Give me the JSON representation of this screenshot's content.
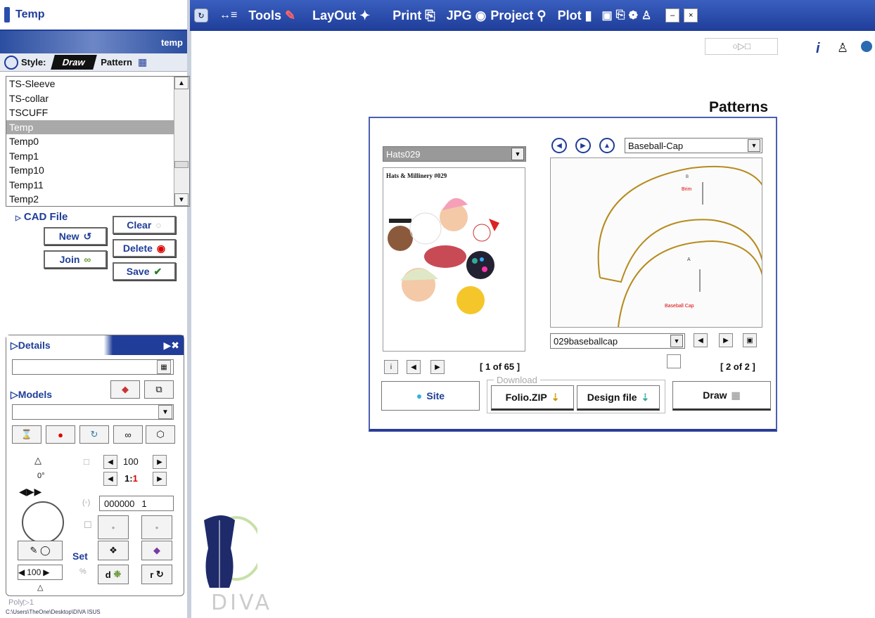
{
  "window": {
    "title": "Temp"
  },
  "toolbar": {
    "tools": "Tools",
    "layout": "LayOut",
    "print": "Print",
    "jpg": "JPG",
    "project": "Project",
    "plot": "Plot",
    "minimize": "–",
    "close": "×"
  },
  "left": {
    "banner_label": "temp",
    "style_label": "Style:",
    "tab_draw": "Draw",
    "tab_pattern": "Pattern",
    "patterns": [
      "TS-Sleeve",
      "TS-collar",
      "TSCUFF",
      "Temp",
      "Temp0",
      "Temp1",
      "Temp10",
      "Temp11",
      "Temp2"
    ],
    "selected_pattern": "Temp",
    "cad_file": "CAD File",
    "new": "New",
    "join": "Join",
    "clear": "Clear",
    "delete": "Delete",
    "save": "Save",
    "details": "Details",
    "models": "Models",
    "angle": "0°",
    "zoom_value": "100",
    "scale_prefix": "1:",
    "scale_value": "1",
    "counter_value": "000000",
    "counter_index": "1",
    "set": "Set",
    "percent_value": "100",
    "percent_sign": "%",
    "d_label": "d",
    "r_label": "r",
    "poly": "Poly▷1",
    "filepath": "C:\\Users\\TheOne\\Desktop\\DIVA ISUS"
  },
  "main": {
    "title": "Patterns",
    "catalog_select": "Hats029",
    "catalog_header": "Hats & Millinery #029",
    "catalog_counter": "[ 1 of 65 ]",
    "pattern_select": "Baseball-Cap",
    "piece_select": "029baseballcap",
    "piece_counter": "[ 2 of 2 ]",
    "preview_brim": "Brim",
    "preview_cap": "Baseball Cap",
    "preview_a": "A",
    "preview_b": "B",
    "site": "Site",
    "download_label": "Download",
    "folio_zip": "Folio.ZIP",
    "design_file": "Design file",
    "draw": "Draw",
    "brand": "DIVA"
  }
}
